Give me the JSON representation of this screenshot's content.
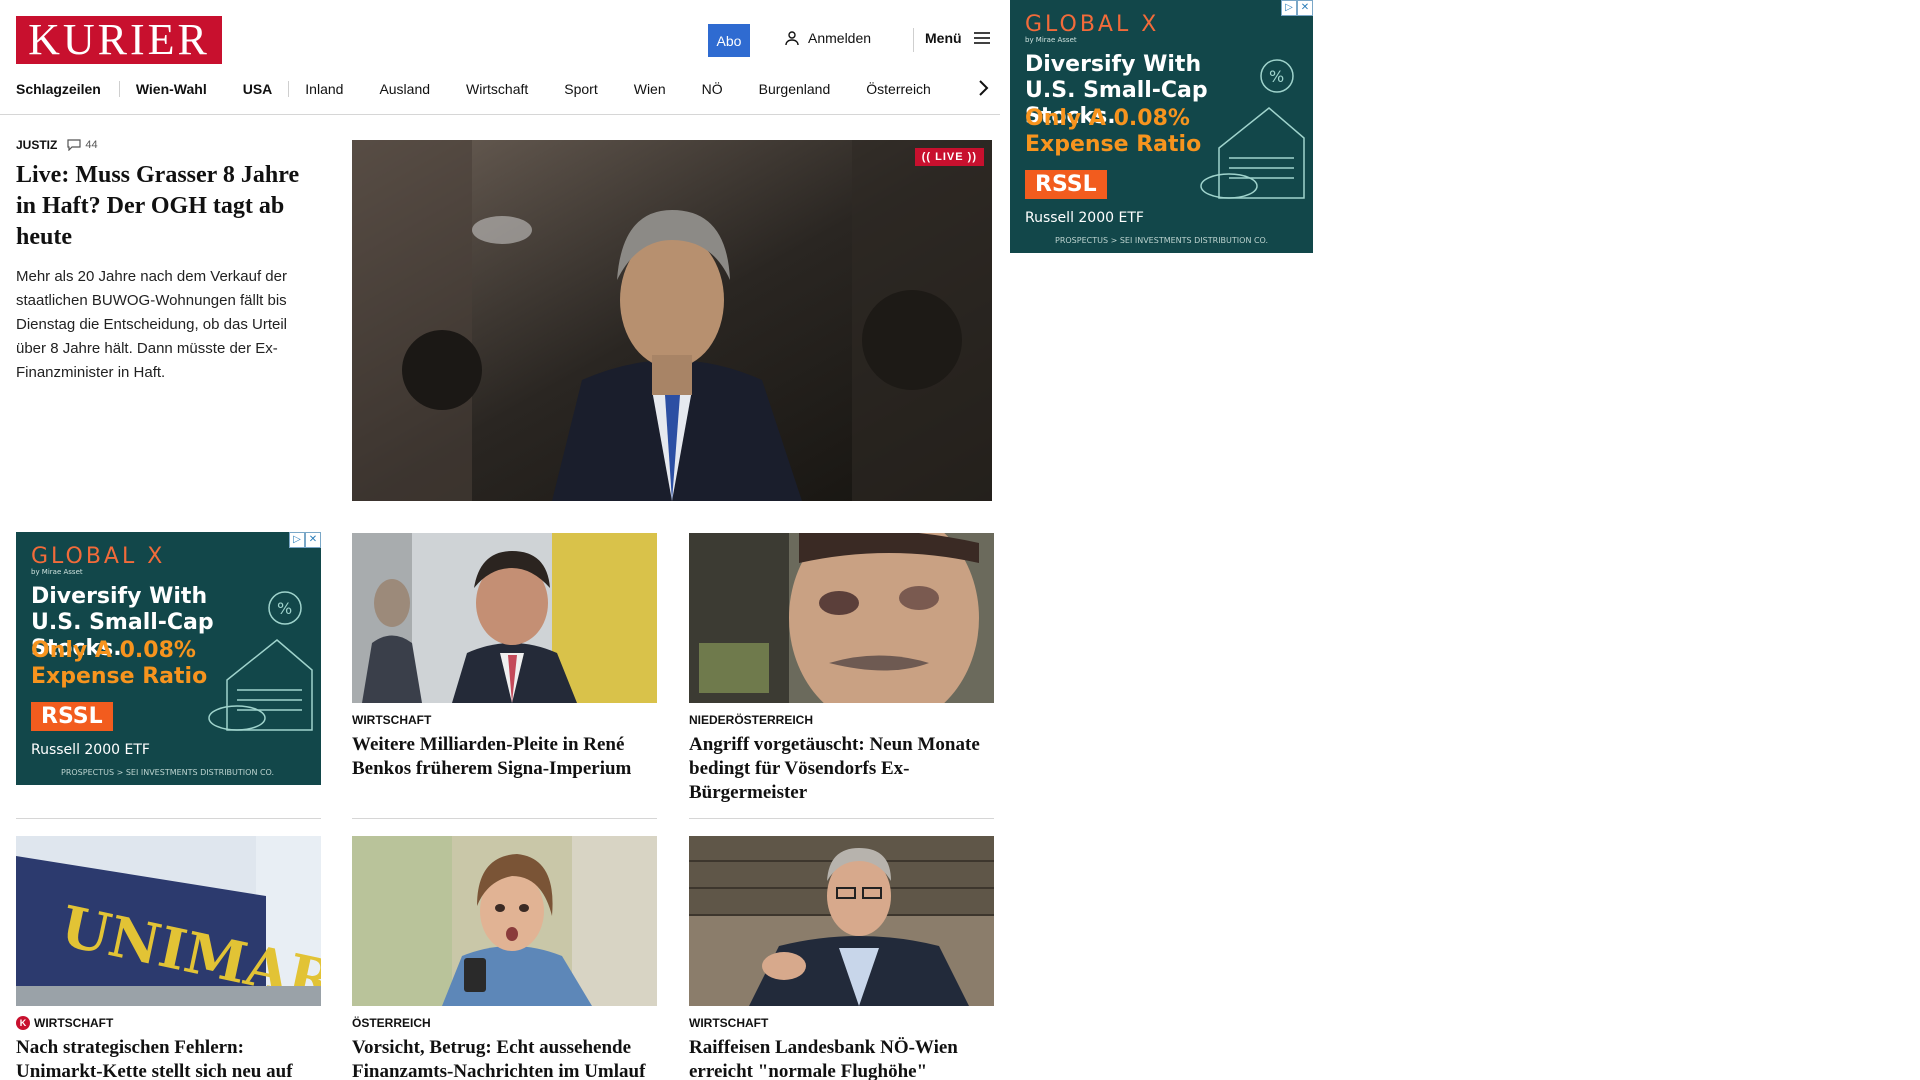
{
  "header": {
    "logo_text": "KURIER",
    "abo_label": "Abo",
    "login_label": "Anmelden",
    "menu_label": "Menü"
  },
  "nav": {
    "items": [
      "Schlagzeilen",
      "Wien-Wahl",
      "USA",
      "Inland",
      "Ausland",
      "Wirtschaft",
      "Sport",
      "Wien",
      "NÖ",
      "Burgenland",
      "Österreich"
    ]
  },
  "lead": {
    "kicker": "JUSTIZ",
    "comment_count": "44",
    "title": "Live: Muss Grasser 8 Jahre in Haft? Der OGH tagt ab heute",
    "teaser": "Mehr als 20 Jahre nach dem Verkauf der staatlichen BUWOG-Wohnungen fällt bis Dienstag die Entscheidung, ob das Urteil über 8 Jahre hält. Dann müsste der Ex-Finanzminister in Haft.",
    "live_label": "LIVE"
  },
  "ad": {
    "brand": "GLOBAL X",
    "brand_sub": "by Mirae Asset",
    "headline": "Diversify With U.S. Small-Cap Stocks.",
    "offer": "Only A 0.08% Expense Ratio",
    "ticker": "RSSL",
    "etf": "Russell 2000 ETF",
    "prospectus": "PROSPECTUS > SEI INVESTMENTS DISTRIBUTION CO.",
    "colors": {
      "background": "#12474a",
      "brand": "#f26b3a",
      "offer": "#f7941e",
      "ticker_bg": "#f25c1e"
    }
  },
  "cards": [
    {
      "kicker": "WIRTSCHAFT",
      "title": "Weitere Milliarden-Pleite in René Benkos früherem Signa-Imperium"
    },
    {
      "kicker": "NIEDERÖSTERREICH",
      "title": "Angriff vorgetäuscht: Neun Monate bedingt für Vösendorfs Ex-Bürgermeister"
    },
    {
      "kicker": "WIRTSCHAFT",
      "title": "Nach strategischen Fehlern: Unimarkt-Kette stellt sich neu auf",
      "plus": true
    },
    {
      "kicker": "ÖSTERREICH",
      "title": "Vorsicht, Betrug: Echt aussehende Finanzamts-Nachrichten im Umlauf"
    },
    {
      "kicker": "WIRTSCHAFT",
      "title": "Raiffeisen Landesbank NÖ-Wien erreicht \"normale Flughöhe\""
    }
  ],
  "colors": {
    "brand_red": "#c8102e",
    "abo_blue": "#2f6bd1"
  }
}
